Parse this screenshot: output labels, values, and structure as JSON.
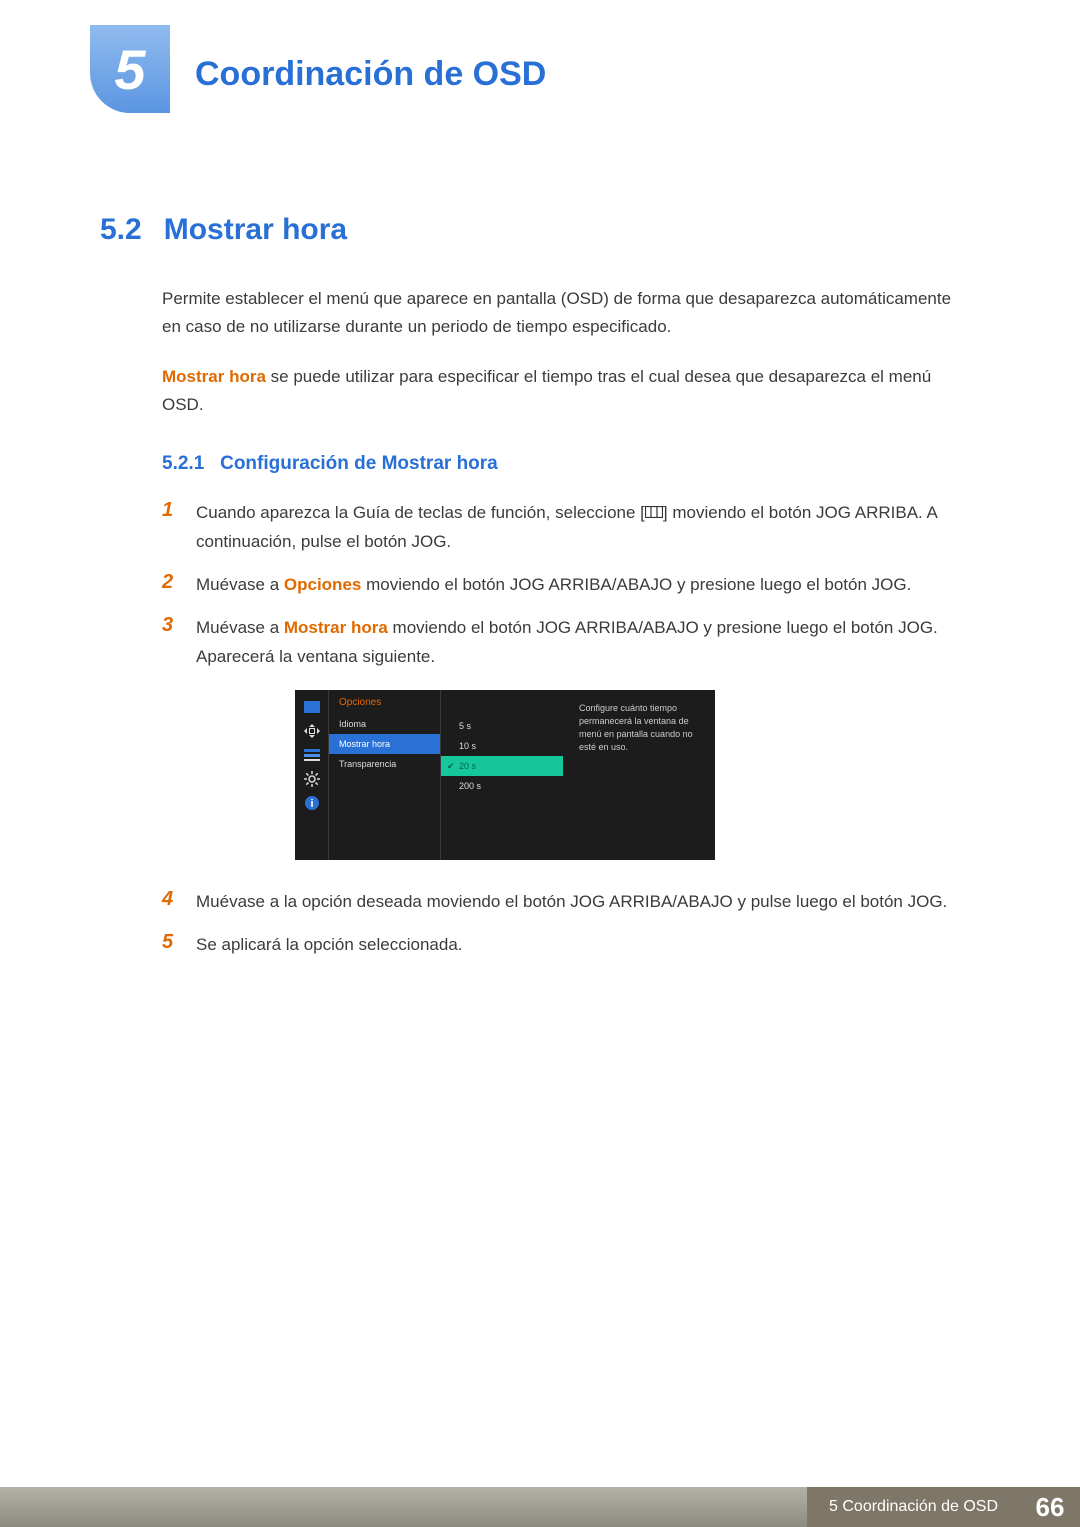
{
  "chapter": {
    "number": "5",
    "title": "Coordinación de OSD"
  },
  "section": {
    "number": "5.2",
    "title": "Mostrar hora"
  },
  "intro": {
    "p1": "Permite establecer el menú que aparece en pantalla (OSD) de forma que desaparezca automáticamente en caso de no utilizarse durante un periodo de tiempo especificado.",
    "p2_lead": "Mostrar hora",
    "p2_rest": " se puede utilizar para especificar el tiempo tras el cual desea que desaparezca el menú OSD."
  },
  "subsection": {
    "number": "5.2.1",
    "title": "Configuración de Mostrar hora"
  },
  "steps": [
    {
      "n": "1",
      "pre": "Cuando aparezca la Guía de teclas de función, seleccione [",
      "post": "] moviendo el botón JOG ARRIBA. A continuación, pulse el botón JOG."
    },
    {
      "n": "2",
      "pre": "Muévase a ",
      "em": "Opciones",
      "post": " moviendo el botón JOG ARRIBA/ABAJO y presione luego el botón JOG."
    },
    {
      "n": "3",
      "pre": "Muévase a ",
      "em": "Mostrar hora",
      "post": " moviendo el botón JOG ARRIBA/ABAJO y presione luego el botón JOG. Aparecerá la ventana siguiente."
    },
    {
      "n": "4",
      "text": "Muévase a la opción deseada moviendo el botón JOG ARRIBA/ABAJO y pulse luego el botón JOG."
    },
    {
      "n": "5",
      "text": "Se aplicará la opción seleccionada."
    }
  ],
  "osd": {
    "category": "Opciones",
    "items": [
      "Idioma",
      "Mostrar hora",
      "Transparencia"
    ],
    "options": [
      "5 s",
      "10 s",
      "20 s",
      "200 s"
    ],
    "selected_option": "20 s",
    "help": "Configure cuánto tiempo permanecerá la ventana de menú en pantalla cuando no esté en uso."
  },
  "footer": {
    "text": "5 Coordinación de OSD",
    "page": "66"
  }
}
